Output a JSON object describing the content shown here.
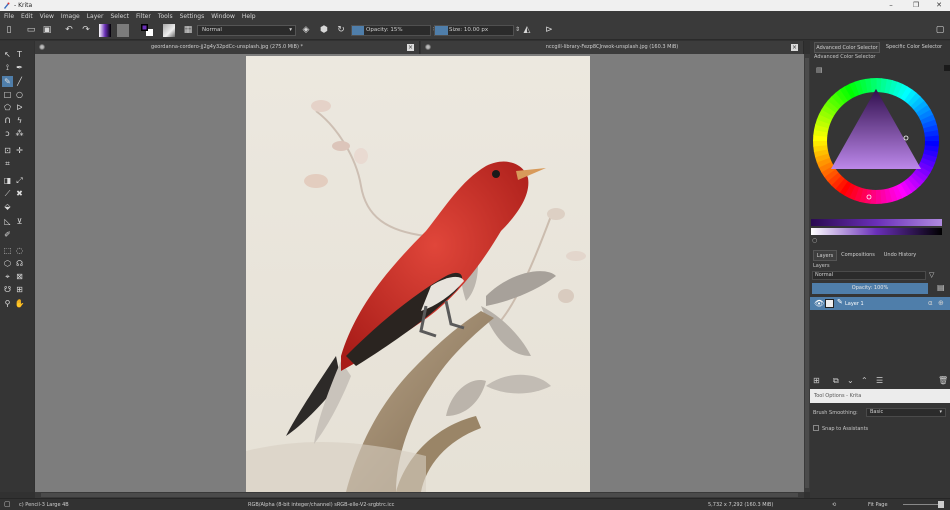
{
  "window": {
    "title": "- Krita",
    "controls": {
      "minimize": "–",
      "maximize": "❐",
      "close": "✕"
    }
  },
  "menu": [
    "File",
    "Edit",
    "View",
    "Image",
    "Layer",
    "Select",
    "Filter",
    "Tools",
    "Settings",
    "Window",
    "Help"
  ],
  "toolbar": {
    "blend_mode": "Normal",
    "opacity_label": "Opacity: 15%",
    "opacity_value": 0.15,
    "size_label": "Size: 10.00 px",
    "fg_color": "#6a2fb8",
    "bg_color": "#7c7c7c"
  },
  "documents": [
    {
      "name": "geordanna-cordero-jj2g4y32pdCc-unsplash.jpg (275.0 MiB) *"
    },
    {
      "name": "nccgill-library-Fezp8CJnwok-unsplash.jpg (160.3 MiB)"
    }
  ],
  "docker": {
    "color_tabs": [
      "Advanced Color Selector",
      "Specific Color Selector"
    ],
    "color_title": "Advanced Color Selector",
    "layer_tabs": [
      "Layers",
      "Compositions",
      "Undo History"
    ],
    "layers_title": "Layers",
    "layer_blend_mode": "Normal",
    "layer_opacity": "Opacity:  100%",
    "layer_name": "Layer 1",
    "tool_options_title": "Tool Options - Krita",
    "brush_smoothing_label": "Brush Smoothing:",
    "brush_smoothing_value": "Basic",
    "snap_label": "Snap to Assistants"
  },
  "status": {
    "brush": "c) Pencil-3 Large 4B",
    "color_model": "RGB/Alpha (8-bit integer/channel)  sRGB-elle-V2-srgbtrc.icc",
    "dimensions": "5,732 x 7,292 (160.3 MiB)",
    "zoom": "Fit Page"
  },
  "colors": {
    "accent": "#4f7eaa",
    "canvas_bg": "#7d7d7d",
    "bird_red": "#c8261f"
  }
}
